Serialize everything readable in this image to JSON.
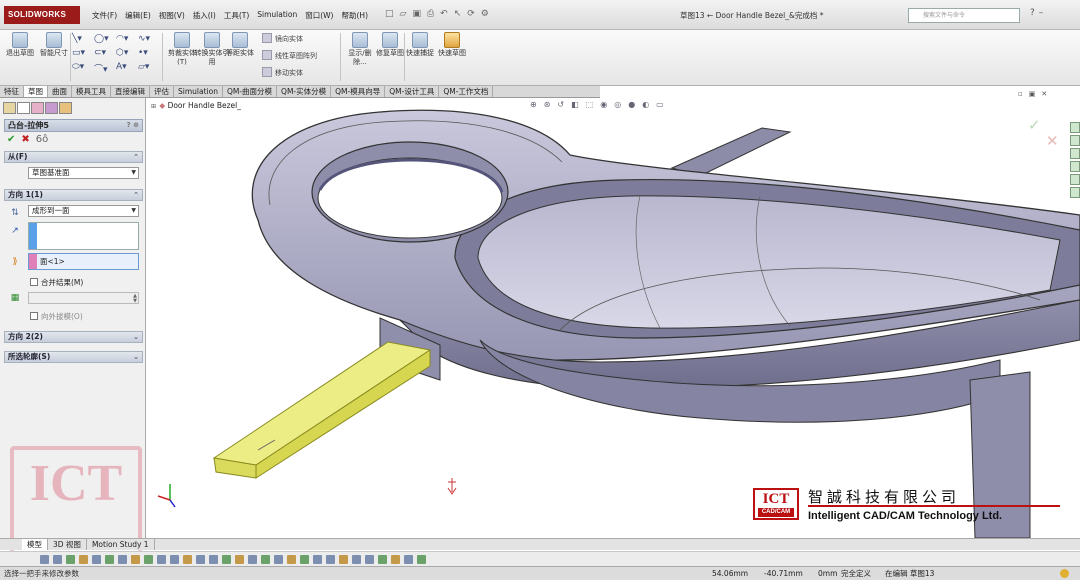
{
  "titlebar": {
    "logo": "SOLIDWORKS",
    "menus": [
      "文件(F)",
      "编辑(E)",
      "视图(V)",
      "插入(I)",
      "工具(T)",
      "Simulation",
      "窗口(W)",
      "帮助(H)"
    ],
    "document_title": "草图13 ← Door Handle Bezel_&完成档 *",
    "search_placeholder": "搜索文件与命令"
  },
  "command_manager": {
    "left_buttons": [
      {
        "label": "退出草图",
        "icon": "exit-sketch-icon"
      },
      {
        "label": "智能尺寸",
        "icon": "smart-dimension-icon"
      }
    ],
    "groups": [
      {
        "label": "剪裁实体(T)",
        "icon": "trim-icon"
      },
      {
        "label": "转换实体引用",
        "icon": "convert-entities-icon"
      },
      {
        "label": "等距实体",
        "icon": "offset-icon"
      }
    ],
    "small_buttons": [
      "镜向实体",
      "线性草图阵列",
      "移动实体"
    ],
    "right_buttons": [
      {
        "label": "显示/删除...",
        "icon": "display-delete-relations-icon"
      },
      {
        "label": "修复草图",
        "icon": "repair-sketch-icon"
      },
      {
        "label": "快速捕捉",
        "icon": "quick-snaps-icon"
      },
      {
        "label": "快速草图",
        "icon": "rapid-sketch-icon"
      }
    ]
  },
  "tabs": [
    "特征",
    "草图",
    "曲面",
    "模具工具",
    "直接编辑",
    "评估",
    "Simulation",
    "QM-曲面分模",
    "QM-实体分模",
    "QM-模具向导",
    "QM-设计工具",
    "QM-工作文档"
  ],
  "active_tab": "草图",
  "property_manager": {
    "feature_name": "凸台-拉伸5",
    "from_section": "从(F)",
    "from_value": "草图基准面",
    "direction1_section": "方向 1(1)",
    "end_condition": "成形到一面",
    "face_selection": "面<1>",
    "merge_result": "合并结果(M)",
    "draft_outward": "向外拔模(O)",
    "direction2_section": "方向 2(2)",
    "selected_contours_section": "所选轮廓(S)"
  },
  "graphics": {
    "tree_item": "Door Handle Bezel_",
    "brand_cn": "智誠科技有限公司",
    "brand_en": "Intelligent CAD/CAM Technology Ltd.",
    "brand_logo": "ICT",
    "brand_logo_sub": "CAD/CAM",
    "watermark": "ICT",
    "body_color": "#a9a8c2",
    "highlight_color": "#e8e86a"
  },
  "bottom_tabs": [
    "模型",
    "3D 视图",
    "Motion Study 1"
  ],
  "active_bottom_tab": "模型",
  "status": {
    "message": "选择一把手来修改参数",
    "x": "54.06mm",
    "y": "-40.71mm",
    "z": "0mm",
    "state": "完全定义",
    "editing": "在编辑 草图13"
  }
}
